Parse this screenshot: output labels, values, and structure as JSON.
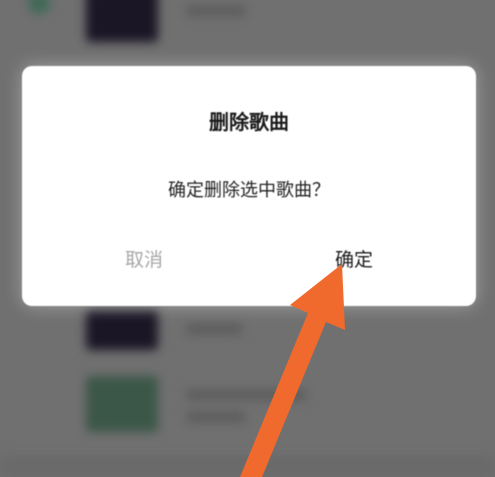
{
  "dialog": {
    "title": "删除歌曲",
    "message": "确定删除选中歌曲？",
    "cancel_label": "取消",
    "confirm_label": "确定"
  },
  "annotation": {
    "arrow_color": "#F06A2E",
    "arrow_target": "confirm-button"
  },
  "colors": {
    "overlay": "#707070",
    "dialog_bg": "#FFFFFF",
    "cancel_text": "#A8A8A8",
    "confirm_text": "#1C1C1C"
  }
}
